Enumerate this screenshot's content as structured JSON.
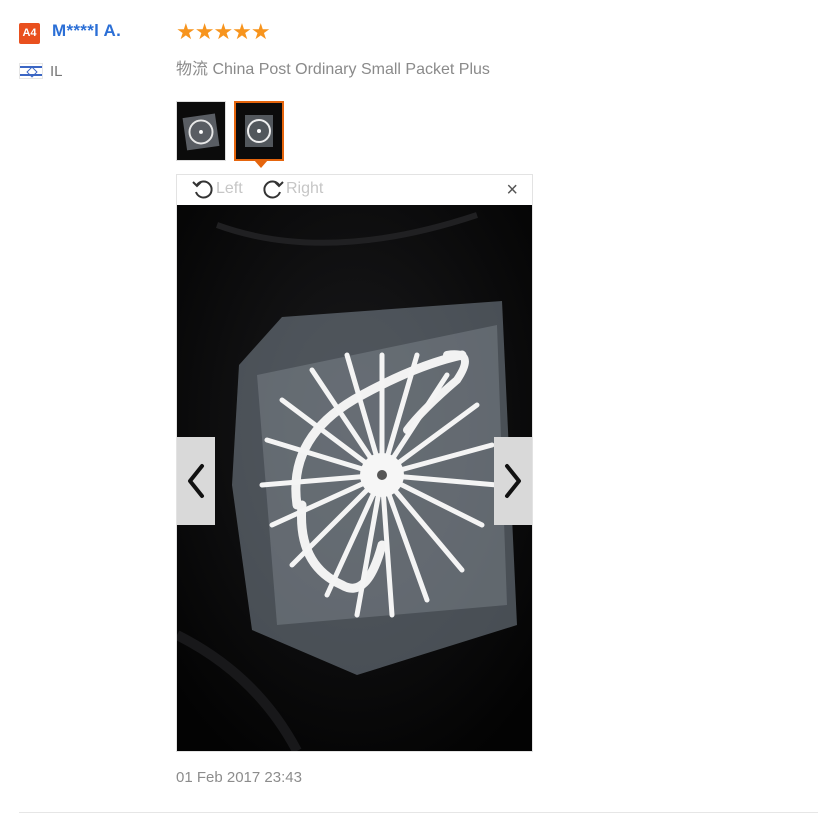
{
  "reviewer": {
    "badge": "A4",
    "name": "M****l A.",
    "country_code": "IL",
    "flag_icon": "israel-flag-icon"
  },
  "review": {
    "rating": 5,
    "stars": "★★★★★",
    "shipping": "物流 China Post Ordinary Small Packet Plus",
    "date": "01 Feb 2017 23:43"
  },
  "thumbnails": [
    {
      "label": "thumbnail-1",
      "selected": false
    },
    {
      "label": "thumbnail-2",
      "selected": true
    }
  ],
  "viewer": {
    "rotate_left_label": "Left",
    "rotate_right_label": "Right",
    "close_label": "×",
    "prev_icon": "chevron-left-icon",
    "next_icon": "chevron-right-icon"
  },
  "colors": {
    "accent": "#e5650d",
    "star": "#f7941d",
    "name": "#2b6fd6",
    "badge": "#e9501e"
  }
}
